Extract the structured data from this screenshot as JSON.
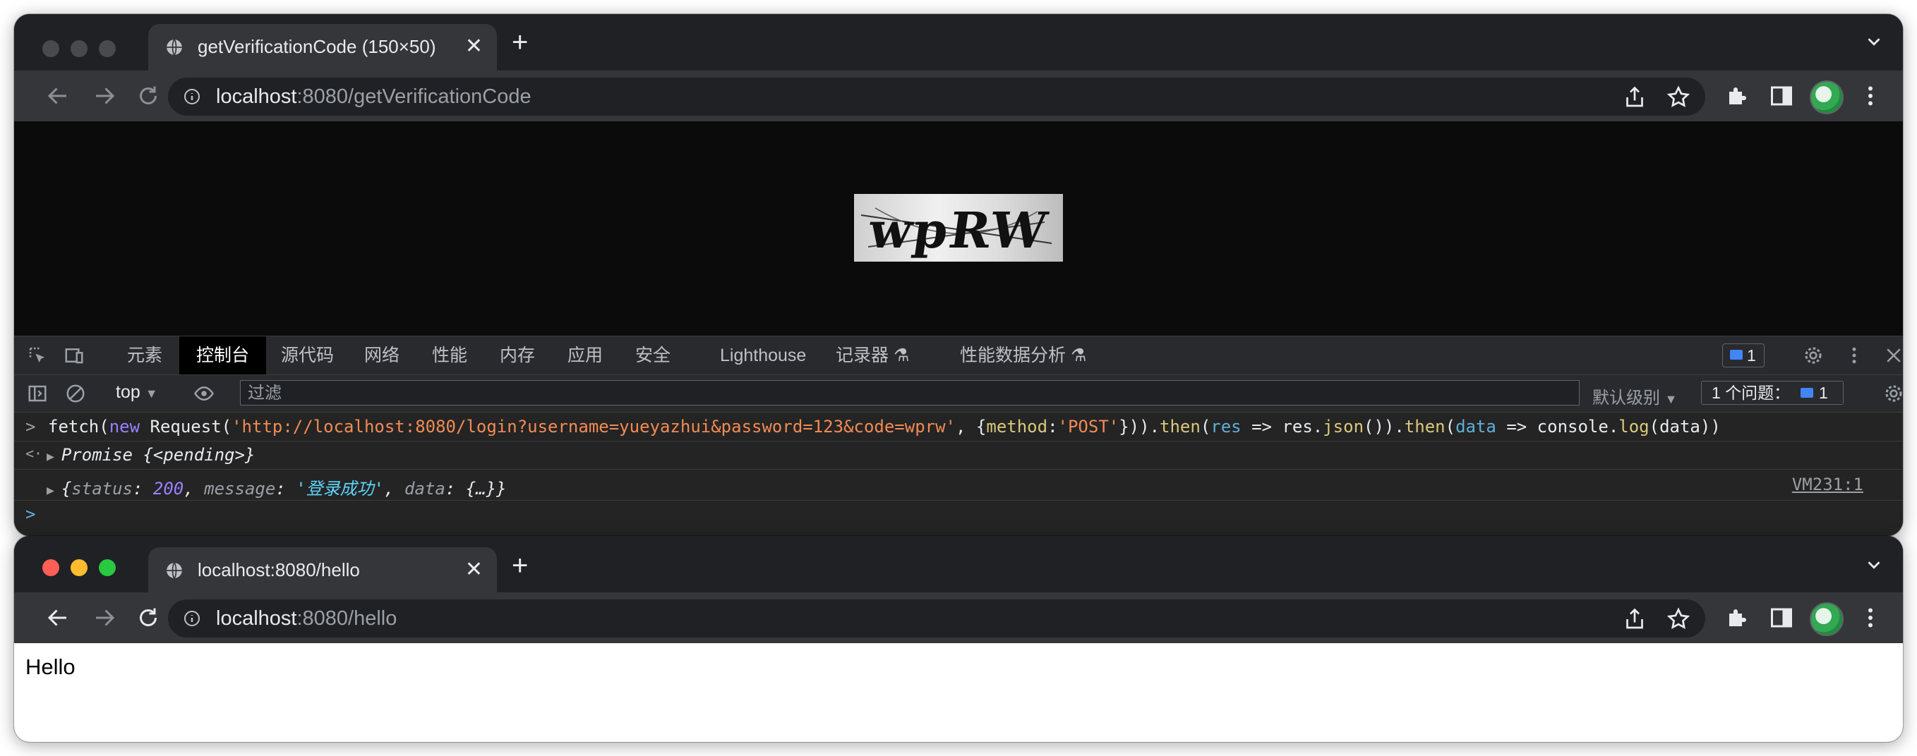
{
  "window1": {
    "tab_title": "getVerificationCode (150×50)",
    "url_host": "localhost",
    "url_path": ":8080/getVerificationCode",
    "captcha_text": "wpRW"
  },
  "devtools": {
    "tabs": [
      "元素",
      "控制台",
      "源代码",
      "网络",
      "性能",
      "内存",
      "应用",
      "安全",
      "Lighthouse",
      "记录器 ⚗",
      "性能数据分析 ⚗"
    ],
    "active_tab": "控制台",
    "message_badge_count": "1",
    "context": "top",
    "filter_placeholder": "过滤",
    "levels_label": "默认级别",
    "issues_label": "1 个问题：",
    "issues_count": "1",
    "console": {
      "input_prefix": ">",
      "result_prefix": "<·",
      "cmd_fetch": "fetch(",
      "cmd_new": "new",
      "cmd_request": " Request(",
      "cmd_url": "'http://localhost:8080/login?username=yueyazhui&password=123&code=wprw'",
      "cmd_mid": ", {",
      "cmd_method_key": "method",
      "cmd_colon": ":",
      "cmd_method_val": "'POST'",
      "cmd_close": "})).",
      "cmd_then1": "then",
      "cmd_paren": "(",
      "cmd_res": "res",
      "cmd_arrow": " => res.",
      "cmd_json": "json",
      "cmd_close2": "()).",
      "cmd_then2": "then",
      "cmd_paren2": "(",
      "cmd_data": "data",
      "cmd_arrow2": " => console.",
      "cmd_log": "log",
      "cmd_end": "(data))",
      "promise_label": "Promise",
      "promise_state": "{<pending>}",
      "obj_open": "{",
      "obj_status_key": "status",
      "obj_status_val": "200",
      "obj_message_key": "message",
      "obj_message_val": "'登录成功'",
      "obj_data_key": "data",
      "obj_data_val": "{…}}",
      "source_link": "VM231:1",
      "prompt": ">"
    }
  },
  "window2": {
    "tab_title": "localhost:8080/hello",
    "url_host": "localhost",
    "url_path": ":8080/hello",
    "body_text": "Hello"
  },
  "colors": {
    "chrome_dark": "#202124",
    "toolbar_dark": "#35363a",
    "traffic_red": "#ff5f57",
    "traffic_yellow": "#febc2e",
    "traffic_green": "#28c840"
  }
}
